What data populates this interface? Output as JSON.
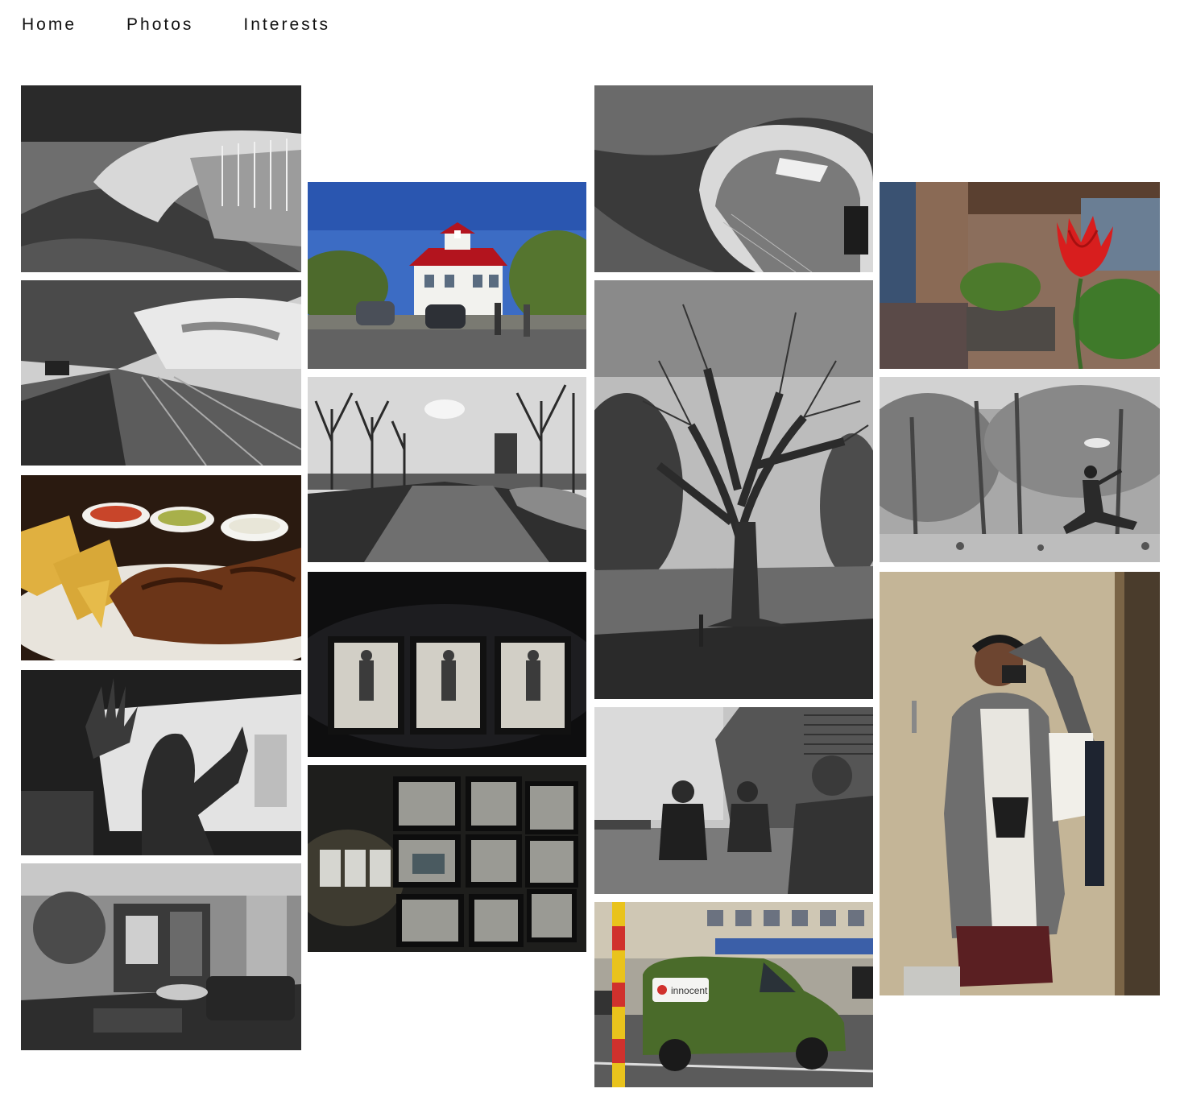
{
  "nav": {
    "items": [
      {
        "label": "Home"
      },
      {
        "label": "Photos"
      },
      {
        "label": "Interests"
      }
    ]
  },
  "gallery": {
    "photos": [
      {
        "subject": "curved-station-hall",
        "palette": "bw"
      },
      {
        "subject": "railway-platform",
        "palette": "bw"
      },
      {
        "subject": "nachos-and-ribs",
        "palette": "color"
      },
      {
        "subject": "shadow-hands",
        "palette": "bw"
      },
      {
        "subject": "living-room",
        "palette": "bw"
      },
      {
        "subject": "red-roof-house",
        "palette": "color"
      },
      {
        "subject": "canal-trees",
        "palette": "bw"
      },
      {
        "subject": "triptych-portraits",
        "palette": "dark"
      },
      {
        "subject": "gallery-wall-prints",
        "palette": "dark"
      },
      {
        "subject": "curved-interior",
        "palette": "bw"
      },
      {
        "subject": "big-old-tree",
        "palette": "bw"
      },
      {
        "subject": "friends-cafe-terrace",
        "palette": "bw"
      },
      {
        "subject": "green-grass-van",
        "palette": "color",
        "van_text": "innocent"
      },
      {
        "subject": "red-tulip",
        "palette": "color"
      },
      {
        "subject": "frisbee-park",
        "palette": "bw"
      },
      {
        "subject": "mirror-selfie",
        "palette": "color"
      }
    ]
  }
}
